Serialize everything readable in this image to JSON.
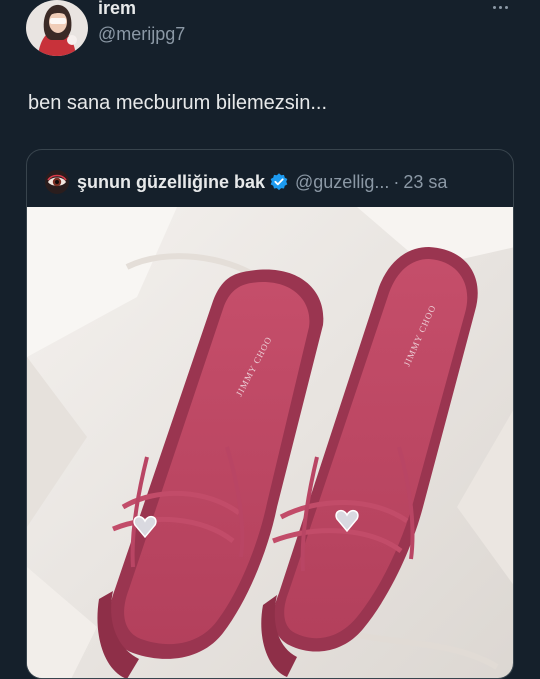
{
  "tweet": {
    "author_name": "irem",
    "author_handle": "@merijpg7",
    "text": "ben sana mecburum bilemezsin..."
  },
  "quote": {
    "name": "şunun güzelliğine bak",
    "handle": "@guzellig...",
    "separator": "·",
    "time": "23 sa",
    "verified_color": "#1d9bf0"
  },
  "media": {
    "box_brand": "JIMMY CHOO",
    "description_icon": "photo-pink-heart-sandals"
  },
  "colors": {
    "background": "#15202b",
    "text_primary": "#e7e9ea",
    "text_secondary": "#8b98a5",
    "border": "#38444d",
    "accent": "#1d9bf0"
  }
}
